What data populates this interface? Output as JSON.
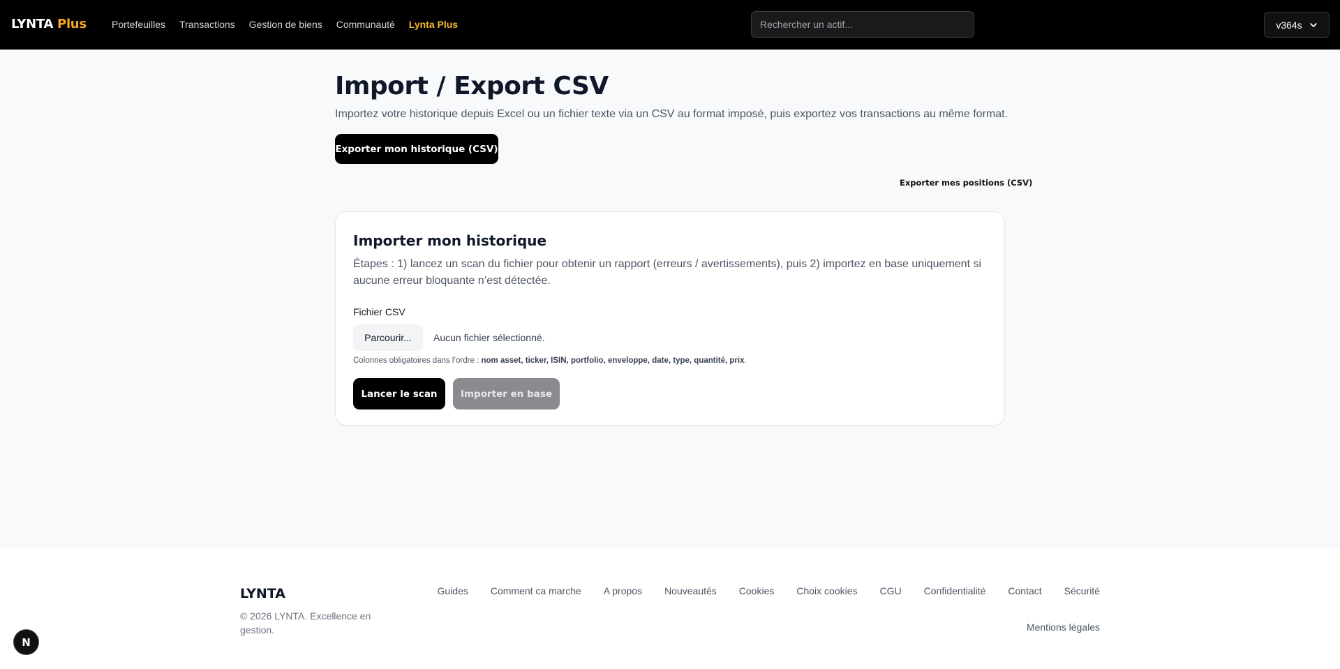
{
  "header": {
    "brand_main": "LYNTA",
    "brand_plus": "Plus",
    "nav": [
      {
        "label": "Portefeuilles"
      },
      {
        "label": "Transactions"
      },
      {
        "label": "Gestion de biens"
      },
      {
        "label": "Communauté"
      },
      {
        "label": "Lynta Plus"
      }
    ],
    "search_placeholder": "Rechercher un actif...",
    "user_label": "v364s"
  },
  "main": {
    "title": "Import / Export CSV",
    "description": "Importez votre historique depuis Excel ou un fichier texte via un CSV au format imposé, puis exportez vos transactions au même format.",
    "export_history_label": "Exporter mon historique (CSV)",
    "export_positions_label": "Exporter mes positions (CSV)"
  },
  "import_card": {
    "title": "Importer mon historique",
    "description": "Étapes : 1) lancez un scan du fichier pour obtenir un rapport (erreurs / avertissements), puis 2) importez en base uniquement si aucune erreur bloquante n’est détectée.",
    "field_label": "Fichier CSV",
    "browse_label": "Parcourir...",
    "file_status": "Aucun fichier sélectionné.",
    "columns_prefix": "Colonnes obligatoires dans l’ordre : ",
    "columns_list": "nom asset, ticker, ISIN, portfolio, enveloppe, date, type, quantité, prix",
    "columns_suffix": ".",
    "scan_label": "Lancer le scan",
    "import_label": "Importer en base"
  },
  "footer": {
    "brand": "LYNTA",
    "copyright": "© 2026 LYNTA. Excellence en gestion.",
    "links": [
      {
        "label": "Guides"
      },
      {
        "label": "Comment ca marche"
      },
      {
        "label": "A propos"
      },
      {
        "label": "Nouveautés"
      },
      {
        "label": "Cookies"
      },
      {
        "label": "Choix cookies"
      },
      {
        "label": "CGU"
      },
      {
        "label": "Confidentialité"
      },
      {
        "label": "Contact"
      },
      {
        "label": "Sécurité"
      }
    ],
    "legal": "Mentions légales"
  },
  "dev_badge": "N",
  "colors": {
    "accent": "#f5b82e",
    "header_bg": "#000000",
    "page_bg": "#f8f9fb",
    "disabled_button": "#8b8b8f"
  }
}
